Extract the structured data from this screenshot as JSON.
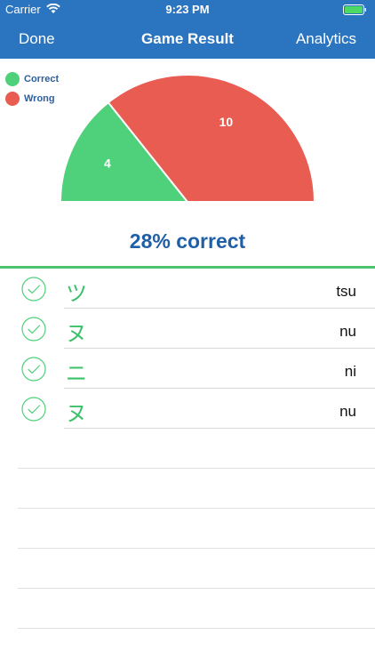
{
  "status_bar": {
    "carrier": "Carrier",
    "time": "9:23 PM"
  },
  "nav": {
    "left_button": "Done",
    "title": "Game Result",
    "right_button": "Analytics"
  },
  "colors": {
    "nav_background": "#2a74c0",
    "correct": "#4fd07a",
    "wrong": "#e85c52",
    "accent_text": "#1f5fa8"
  },
  "chart_data": {
    "type": "pie",
    "variant": "half-donut",
    "title": "",
    "legend_position": "top-left",
    "slices": [
      {
        "label": "Correct",
        "value": 4,
        "color": "#4fd07a"
      },
      {
        "label": "Wrong",
        "value": 10,
        "color": "#e85c52"
      }
    ]
  },
  "summary": {
    "result_text": "28% correct"
  },
  "answers": [
    {
      "kana": "ツ",
      "romaji": "tsu",
      "status": "correct"
    },
    {
      "kana": "ヌ",
      "romaji": "nu",
      "status": "correct"
    },
    {
      "kana": "ニ",
      "romaji": "ni",
      "status": "correct"
    },
    {
      "kana": "ヌ",
      "romaji": "nu",
      "status": "correct"
    }
  ],
  "icons": {
    "wifi": "wifi-icon",
    "battery": "battery-icon",
    "row_status": "check-circle-icon"
  }
}
